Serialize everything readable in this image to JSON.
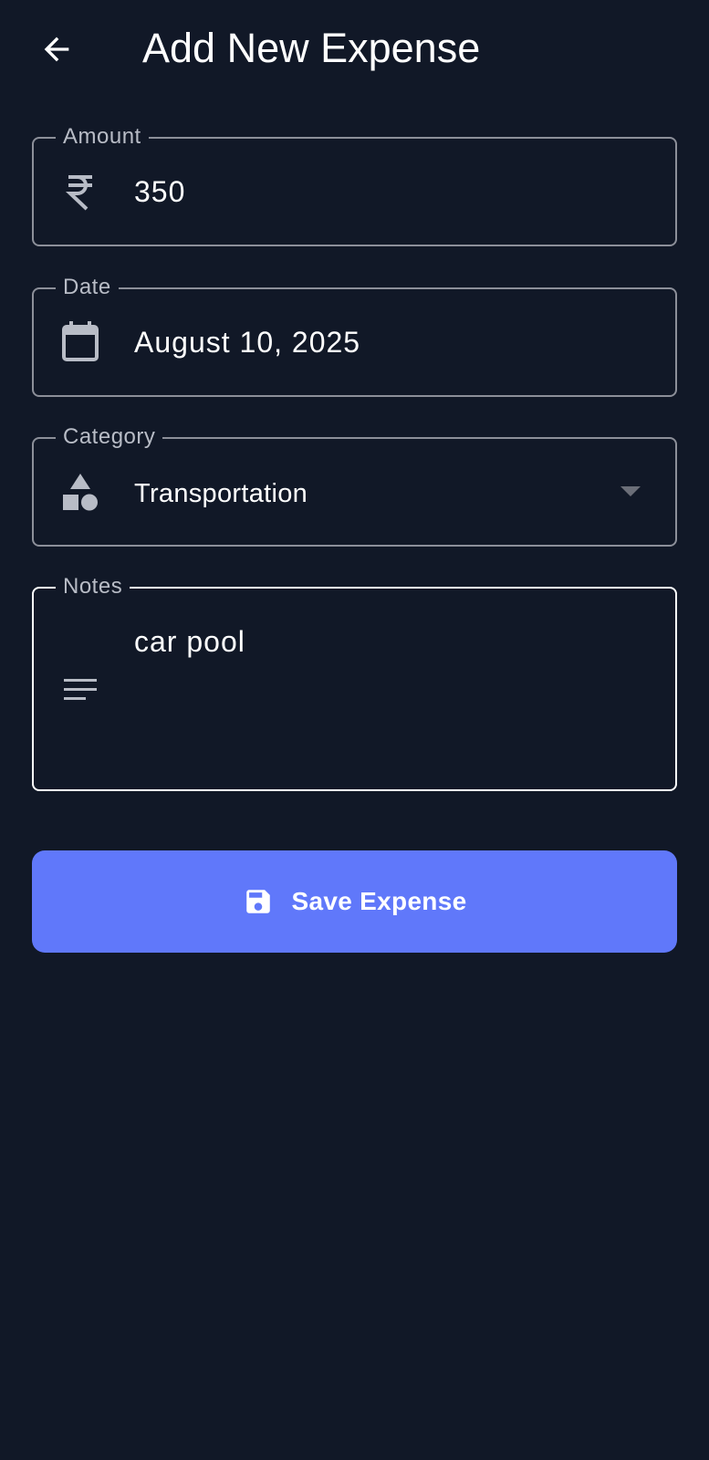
{
  "app_bar": {
    "back_icon": "arrow-back-icon",
    "title": "Add New Expense"
  },
  "form": {
    "amount": {
      "label": "Amount",
      "icon": "rupee-icon",
      "value": "350"
    },
    "date": {
      "label": "Date",
      "icon": "calendar-icon",
      "value": "August 10, 2025"
    },
    "category": {
      "label": "Category",
      "icon": "category-shapes-icon",
      "value": "Transportation"
    },
    "notes": {
      "label": "Notes",
      "icon": "notes-lines-icon",
      "value": "car pool"
    }
  },
  "save_button": {
    "icon": "save-icon",
    "label": "Save Expense"
  },
  "colors": {
    "background": "#111827",
    "accent": "#6078fa",
    "field_border": "#8c8f99",
    "focused_border": "#ffffff",
    "label": "#b8bcc6",
    "icon": "#b8bcc6"
  }
}
